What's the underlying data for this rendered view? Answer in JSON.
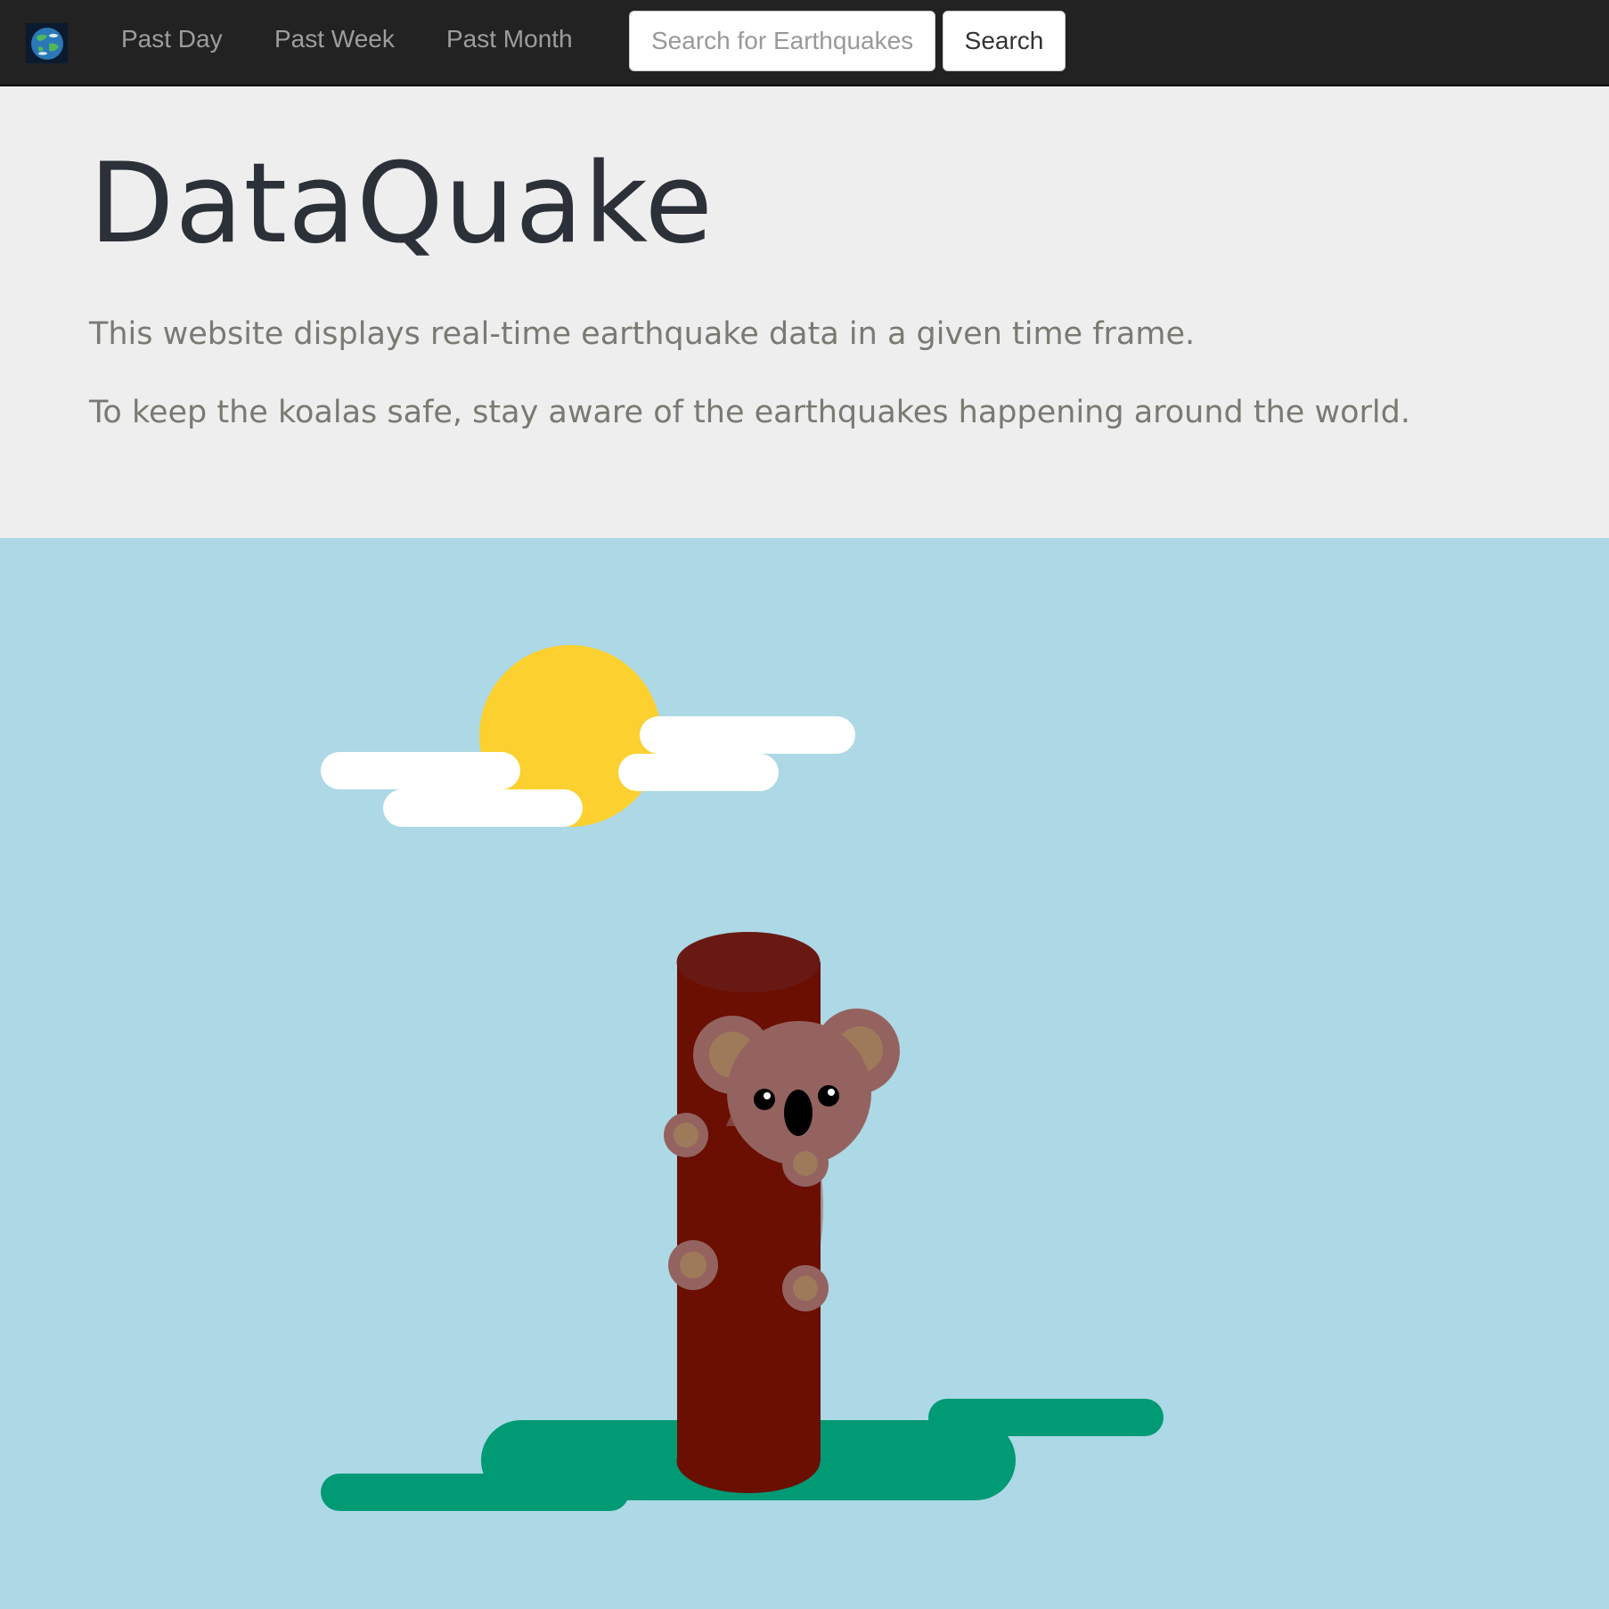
{
  "nav": {
    "logo_icon": "earth-globe-icon",
    "links": [
      {
        "label": "Past Day"
      },
      {
        "label": "Past Week"
      },
      {
        "label": "Past Month"
      }
    ],
    "search": {
      "placeholder": "Search for Earthquakes",
      "value": "",
      "button_label": "Search"
    }
  },
  "hero": {
    "title": "DataQuake",
    "lines": [
      "This website displays real-time earthquake data in a given time frame.",
      "To keep the koalas safe, stay aware of the earthquakes happening around the world."
    ]
  },
  "colors": {
    "navbar": "#222222",
    "jumbotron": "#eeeeee",
    "sky": "#add8e6",
    "sun": "#fbd02f",
    "grass": "#009a75",
    "trunk": "#6a0f02",
    "koala": "#946360"
  }
}
